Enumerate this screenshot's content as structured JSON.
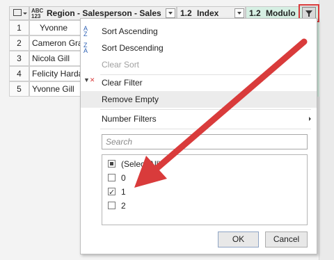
{
  "table": {
    "columns": [
      {
        "type": "ABC\n123",
        "name": "Region - Salesperson - Sales"
      },
      {
        "type": "1.2",
        "name": "Index"
      },
      {
        "type": "1.2",
        "name": "Modulo"
      }
    ],
    "rows": [
      {
        "num": "1",
        "name": "Yvonne Vau"
      },
      {
        "num": "2",
        "name": "Cameron Gray"
      },
      {
        "num": "3",
        "name": "Nicola Gill"
      },
      {
        "num": "4",
        "name": "Felicity Hardac"
      },
      {
        "num": "5",
        "name": "Yvonne Gill"
      }
    ]
  },
  "menu": {
    "sort_ascending": "Sort Ascending",
    "sort_descending": "Sort Descending",
    "clear_sort": "Clear Sort",
    "clear_filter": "Clear Filter",
    "remove_empty": "Remove Empty",
    "number_filters": "Number Filters",
    "search_placeholder": "Search",
    "list_items": [
      {
        "label": "(Select All)",
        "state": "partial"
      },
      {
        "label": "0",
        "state": "unchecked"
      },
      {
        "label": "1",
        "state": "checked"
      },
      {
        "label": "2",
        "state": "unchecked"
      }
    ],
    "ok": "OK",
    "cancel": "Cancel"
  },
  "colors": {
    "accent_red": "#d93b3b",
    "modulo_header": "#d6efe3"
  }
}
